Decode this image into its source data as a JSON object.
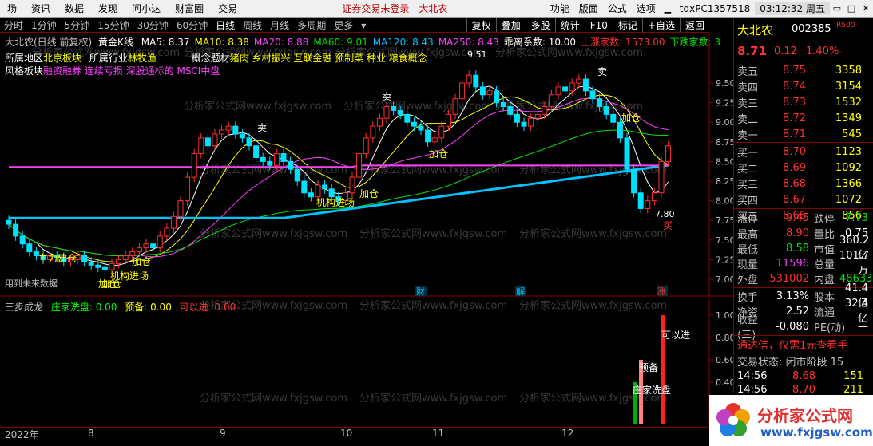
{
  "menu": {
    "items": [
      "场",
      "资讯",
      "数据",
      "发现",
      "问小达",
      "财富圈",
      "交易"
    ],
    "warning": "证券交易未登录",
    "stock_short": "大北农",
    "right_items": [
      "功能",
      "版面",
      "公式",
      "选项"
    ],
    "account": "tdxPC1357518",
    "clock": "03:12:32 周五"
  },
  "periods": [
    "分时",
    "1分钟",
    "5分钟",
    "15分钟",
    "30分钟",
    "60分钟",
    "日线",
    "周线",
    "月线",
    "多周期",
    "更多"
  ],
  "active_period": "日线",
  "toolbar": [
    "复权",
    "叠加",
    "多股",
    "统计",
    "F10",
    "标记",
    "+自选",
    "返回"
  ],
  "main_chart": {
    "title": "大北农(日线 前复权)",
    "indicator": "黄金K线",
    "ma": [
      {
        "label": "MA5: 8.37",
        "color": "#ffffff"
      },
      {
        "label": "MA10: 8.38",
        "color": "#ffff00"
      },
      {
        "label": "MA20: 8.88",
        "color": "#ff40ff"
      },
      {
        "label": "MA60: 9.01",
        "color": "#00e000"
      },
      {
        "label": "MA120: 8.43",
        "color": "#00c0ff"
      },
      {
        "label": "MA250: 8.43",
        "color": "#ff40ff"
      },
      {
        "label": "乖离系数: 10.00",
        "color": "#ffffff"
      },
      {
        "label": "上涨家数: 1573.00",
        "color": "#ff3030"
      },
      {
        "label": "下跌家数: 3",
        "color": "#00e000"
      }
    ],
    "info_lines": [
      {
        "label": "所属地区",
        "value": "北京板块"
      },
      {
        "label": "所属行业",
        "value": "林牧渔"
      },
      {
        "label": "概念题材",
        "value": "猪肉 乡村振兴 互联金融 预制菜 种业 粮食概念"
      },
      {
        "label": "风格板块",
        "value": "融资融券 连续亏损 深股通标的 MSCI中盘"
      }
    ],
    "future_note": "用到未来数据",
    "y_ticks": [
      "9.50",
      "9.25",
      "9.00",
      "8.75",
      "8.50",
      "8.25",
      "8.00",
      "7.75",
      "7.50",
      "7.25",
      "7.00"
    ],
    "high_mark": "9.51",
    "low_mark": "7.80",
    "annotations": [
      "卖",
      "卖",
      "卖",
      "加仓",
      "加仓",
      "加仓",
      "加仓",
      "加仓",
      "主力建仓",
      "机构进场",
      "机构进场",
      "加仓",
      "买"
    ],
    "event_tags": [
      "财",
      "解",
      "涨"
    ],
    "watermark": "分析家公式网www.fxjgsw.com"
  },
  "sub_chart": {
    "title": "三步成龙",
    "fields": [
      {
        "label": "庄家洗盘: 0.00",
        "color": "#00ff00"
      },
      {
        "label": "预备: 0.00",
        "color": "#ffff00"
      },
      {
        "label": "可以进: 0.00",
        "color": "#ff3030"
      }
    ],
    "y_ticks": [
      "1.00",
      "0.80",
      "0.60",
      "0.40",
      "0.20"
    ],
    "bar_labels": [
      "庄家洗盘",
      "预备",
      "可以进"
    ],
    "bar_values": [
      0.4,
      0.6,
      1.0
    ]
  },
  "x_axis": [
    "2022年",
    "8",
    "9",
    "10",
    "11",
    "12"
  ],
  "quote": {
    "name": "大北农",
    "code": "002385",
    "badge": "R500",
    "price": "8.71",
    "change": "0.12",
    "pct": "1.40%",
    "asks": [
      {
        "k": "卖五",
        "v": "8.75",
        "n": "3358"
      },
      {
        "k": "卖四",
        "v": "8.74",
        "n": "3154"
      },
      {
        "k": "卖三",
        "v": "8.73",
        "n": "1532"
      },
      {
        "k": "卖二",
        "v": "8.72",
        "n": "1349"
      },
      {
        "k": "卖一",
        "v": "8.71",
        "n": "545"
      }
    ],
    "bids": [
      {
        "k": "买一",
        "v": "8.70",
        "n": "1123"
      },
      {
        "k": "买二",
        "v": "8.69",
        "n": "1092"
      },
      {
        "k": "买三",
        "v": "8.68",
        "n": "1366"
      },
      {
        "k": "买四",
        "v": "8.67",
        "n": "1072"
      },
      {
        "k": "买五",
        "v": "8.66",
        "n": "856"
      }
    ],
    "stats": [
      {
        "k": "涨停",
        "v": "9.45",
        "k2": "跌停",
        "v2": "7.73"
      },
      {
        "k": "最高",
        "v": "8.90",
        "k2": "量比",
        "v2": "0.75"
      },
      {
        "k": "最低",
        "v": "8.58",
        "k2": "市值",
        "v2": "360.2亿"
      },
      {
        "k": "现量",
        "v": "11596",
        "k2": "总量",
        "v2": "101.7万"
      },
      {
        "k": "外盘",
        "v": "531002",
        "k2": "内盘",
        "v2": "486335"
      }
    ],
    "finance": [
      {
        "k": "换手",
        "v": "3.13%",
        "k2": "股本",
        "v2": "41.4亿"
      },
      {
        "k": "净资",
        "v": "2.52",
        "k2": "流通",
        "v2": "32.4亿"
      },
      {
        "k": "收益(三)",
        "v": "-0.080",
        "k2": "PE(动)",
        "v2": "—"
      }
    ],
    "promo": "通达信，仅需1元查看手",
    "trade_status": "交易状态: 闭市阶段 15",
    "ticks": [
      {
        "t": "14:56",
        "p": "8.68",
        "v": "151"
      },
      {
        "t": "14:56",
        "p": "8.70",
        "v": "211"
      }
    ]
  },
  "logo_text": "分析家公式网",
  "logo_url": "www.fxjgsw.com"
}
